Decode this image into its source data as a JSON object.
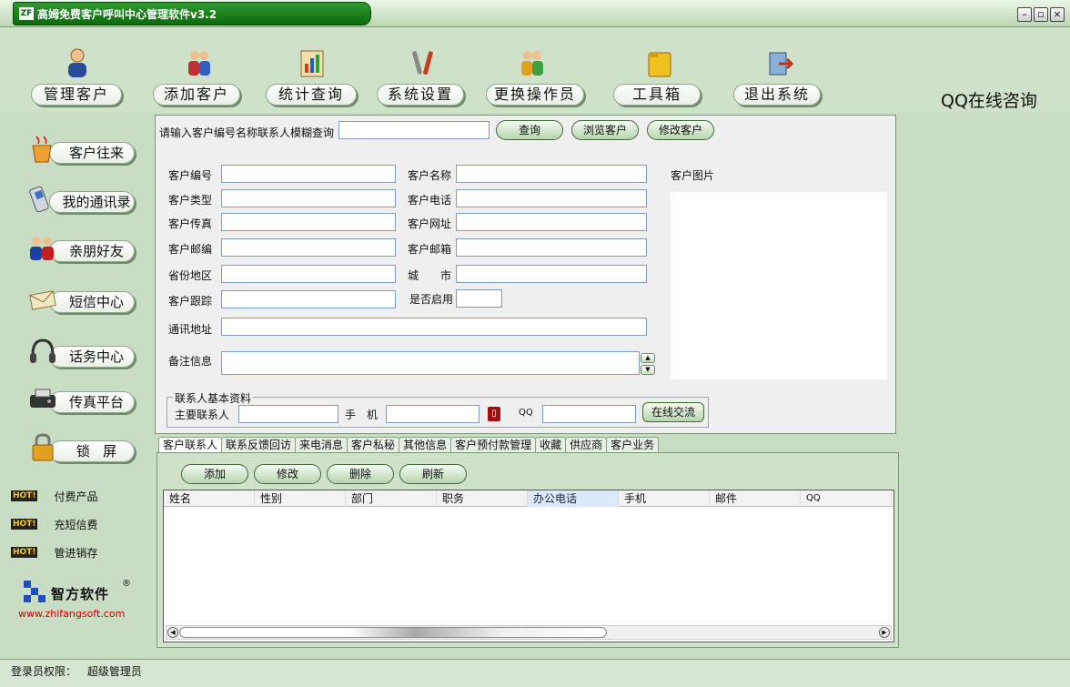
{
  "window": {
    "title": "高姆免费客户呼叫中心管理软件v3.2",
    "logo_text": "ZF"
  },
  "toolbar": [
    {
      "label": "管理客户",
      "icon": "customer-person-icon"
    },
    {
      "label": "添加客户",
      "icon": "add-customers-icon"
    },
    {
      "label": "统计查询",
      "icon": "statistics-query-icon"
    },
    {
      "label": "系统设置",
      "icon": "tools-settings-icon"
    },
    {
      "label": "更换操作员",
      "icon": "switch-operator-icon"
    },
    {
      "label": "工具箱",
      "icon": "toolbox-folder-icon"
    },
    {
      "label": "退出系统",
      "icon": "exit-system-icon"
    }
  ],
  "qq_online": "QQ在线咨询",
  "sidebar": {
    "items": [
      {
        "label": "客户往来",
        "icon": "coffee-cup-icon"
      },
      {
        "label": "我的通讯录",
        "icon": "address-book-icon"
      },
      {
        "label": "亲朋好友",
        "icon": "friends-icon"
      },
      {
        "label": "短信中心",
        "icon": "sms-icon"
      },
      {
        "label": "话务中心",
        "icon": "headset-icon"
      },
      {
        "label": "传真平台",
        "icon": "fax-icon"
      },
      {
        "label": "锁   屏",
        "icon": "lock-icon"
      }
    ],
    "hot_badge": "HOT!",
    "hot_items": [
      "付费产品",
      "充短信费",
      "管进销存"
    ],
    "company": {
      "name": "智方软件",
      "registered": "®",
      "url": "www.zhifangsoft.com"
    }
  },
  "search": {
    "label": "请输入客户编号名称联系人模糊查询",
    "value": "",
    "buttons": [
      "查询",
      "浏览客户",
      "修改客户"
    ]
  },
  "form": {
    "customer_no": "客户编号",
    "customer_name": "客户名称",
    "customer_photo": "客户图片",
    "customer_type": "客户类型",
    "customer_phone": "客户电话",
    "customer_fax": "客户传真",
    "customer_website": "客户网址",
    "customer_zip": "客户邮编",
    "customer_email": "客户邮箱",
    "province": "省份地区",
    "city": "城　　市",
    "follow_up": "客户跟踪",
    "enabled": "是否启用",
    "address": "通讯地址",
    "remarks": "备注信息"
  },
  "contact_group": {
    "legend": "联系人基本资料",
    "main_contact": "主要联系人",
    "mobile": "手　机",
    "qq": "QQ",
    "chat_button": "在线交流"
  },
  "tabs": [
    "客户联系人",
    "联系反馈回访",
    "来电消息",
    "客户私秘",
    "其他信息",
    "客户预付款管理",
    "收藏",
    "供应商",
    "客户业务"
  ],
  "grid_buttons": [
    "添加",
    "修改",
    "删除",
    "刷新"
  ],
  "grid_columns": [
    "姓名",
    "性别",
    "部门",
    "职务",
    "办公电话",
    "手机",
    "邮件",
    "QQ"
  ],
  "status": {
    "label": "登录员权限：",
    "value": "超级管理员"
  },
  "colors": {
    "background": "#c9dcc4",
    "title_green": "#0c6a0c",
    "accent_border": "#3f6a38"
  }
}
